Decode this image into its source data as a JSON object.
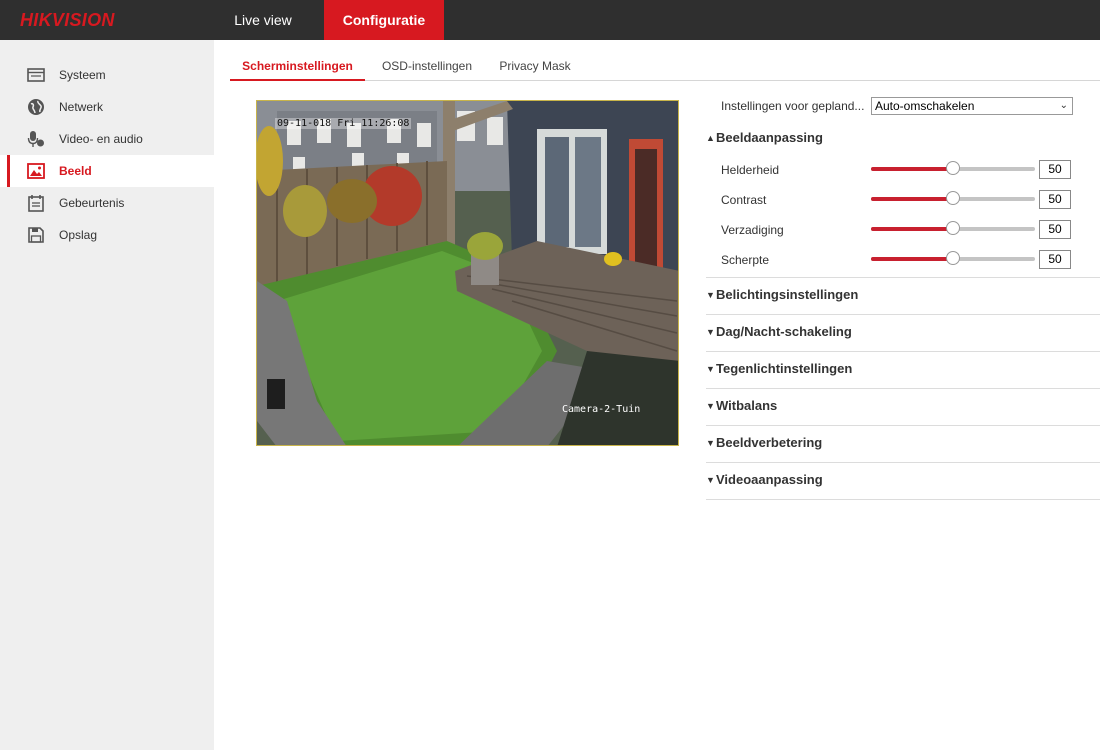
{
  "brand": {
    "logo_text": "HIKVISION",
    "accent": "#d71920"
  },
  "topnav": {
    "live_view": "Live view",
    "config": "Configuratie"
  },
  "sidebar": {
    "items": [
      {
        "label": "Systeem",
        "icon": "monitor-icon"
      },
      {
        "label": "Netwerk",
        "icon": "globe-icon"
      },
      {
        "label": "Video- en audio",
        "icon": "microphone-icon"
      },
      {
        "label": "Beeld",
        "icon": "image-icon",
        "active": true
      },
      {
        "label": "Gebeurtenis",
        "icon": "calendar-icon"
      },
      {
        "label": "Opslag",
        "icon": "storage-icon"
      }
    ]
  },
  "subtabs": [
    "Scherminstellingen",
    "OSD-instellingen",
    "Privacy Mask"
  ],
  "preview": {
    "osd_time": "09-11-018 Fri 11:26:08",
    "osd_name": "Camera-2-Tuin"
  },
  "schedule": {
    "label": "Instellingen voor gepland...",
    "value": "Auto-omschakelen"
  },
  "image_adjust": {
    "title": "Beeldaanpassing",
    "rows": [
      {
        "label": "Helderheid",
        "value": "50",
        "percent": 50
      },
      {
        "label": "Contrast",
        "value": "50",
        "percent": 50
      },
      {
        "label": "Verzadiging",
        "value": "50",
        "percent": 50
      },
      {
        "label": "Scherpte",
        "value": "50",
        "percent": 50
      }
    ]
  },
  "sections": [
    "Belichtingsinstellingen",
    "Dag/Nacht-schakeling",
    "Tegenlichtinstellingen",
    "Witbalans",
    "Beeldverbetering",
    "Videoaanpassing"
  ]
}
